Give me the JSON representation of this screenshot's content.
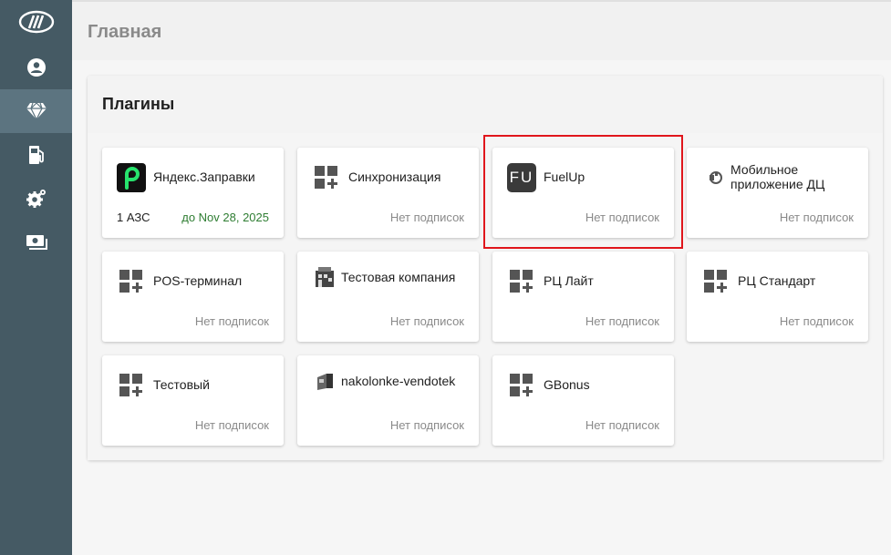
{
  "header": {
    "title": "Главная"
  },
  "sidebar": {
    "items": [
      {
        "icon": "brand-logo-icon"
      },
      {
        "icon": "account-icon"
      },
      {
        "icon": "diamond-icon",
        "active": true
      },
      {
        "icon": "fuel-station-icon"
      },
      {
        "icon": "settings-gear-icon"
      },
      {
        "icon": "money-icon"
      }
    ]
  },
  "plugins": {
    "title": "Плагины",
    "items": [
      {
        "name": "Яндекс.Заправки",
        "icon": "yandex-zapravki-icon",
        "count": "1 АЗС",
        "until": "до Nov 28, 2025"
      },
      {
        "name": "Синхронизация",
        "icon": "plugin-grid-icon",
        "status": "Нет подписок"
      },
      {
        "name": "FuelUp",
        "icon": "fuelup-logo-icon",
        "icon_text": "FU",
        "status": "Нет подписок",
        "highlighted": true
      },
      {
        "name": "Мобильное приложение ДЦ",
        "icon": "mobile-app-icon",
        "status": "Нет подписок"
      },
      {
        "name": "POS-терминал",
        "icon": "plugin-grid-icon",
        "status": "Нет подписок"
      },
      {
        "name": "Тестовая компания",
        "icon": "company-building-icon",
        "status": "Нет подписок"
      },
      {
        "name": "РЦ Лайт",
        "icon": "plugin-grid-icon",
        "status": "Нет подписок"
      },
      {
        "name": "РЦ Стандарт",
        "icon": "plugin-grid-icon",
        "status": "Нет подписок"
      },
      {
        "name": "Тестовый",
        "icon": "plugin-grid-icon",
        "status": "Нет подписок"
      },
      {
        "name": "nakolonke-vendotek",
        "icon": "vendotek-terminal-icon",
        "status": "Нет подписок"
      },
      {
        "name": "GBonus",
        "icon": "plugin-grid-icon",
        "status": "Нет подписок"
      }
    ]
  },
  "colors": {
    "sidebar": "#455a64",
    "sidebar_active": "#5c7480",
    "highlight": "#e0161c",
    "active_until": "#2e7d32"
  }
}
